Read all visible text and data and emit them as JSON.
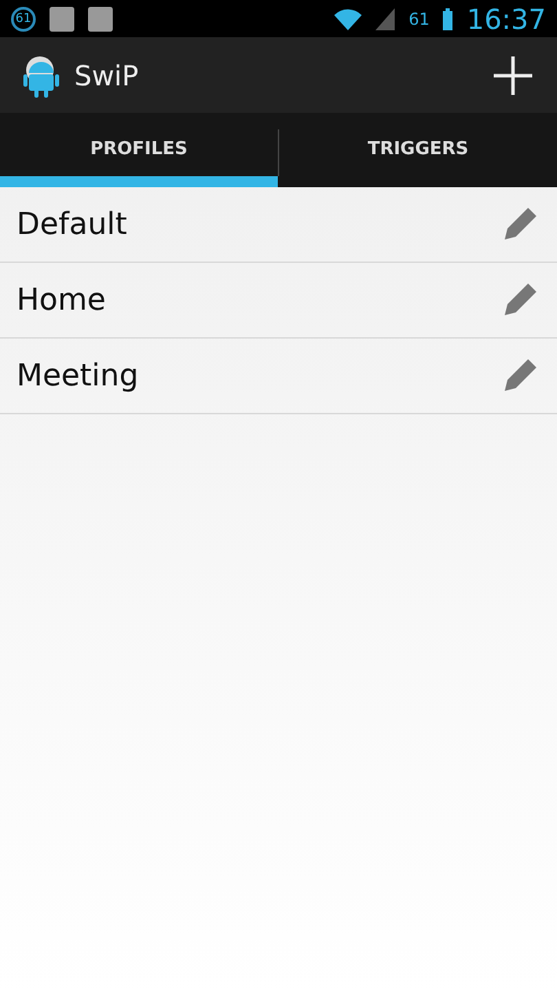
{
  "status_bar": {
    "notification_badge": "61",
    "battery_level_text": "61",
    "time": "16:37"
  },
  "action_bar": {
    "title": "SwiP"
  },
  "tabs": [
    {
      "label": "PROFILES",
      "selected": true
    },
    {
      "label": "TRIGGERS",
      "selected": false
    }
  ],
  "profiles": [
    {
      "name": "Default"
    },
    {
      "name": "Home"
    },
    {
      "name": "Meeting"
    }
  ]
}
